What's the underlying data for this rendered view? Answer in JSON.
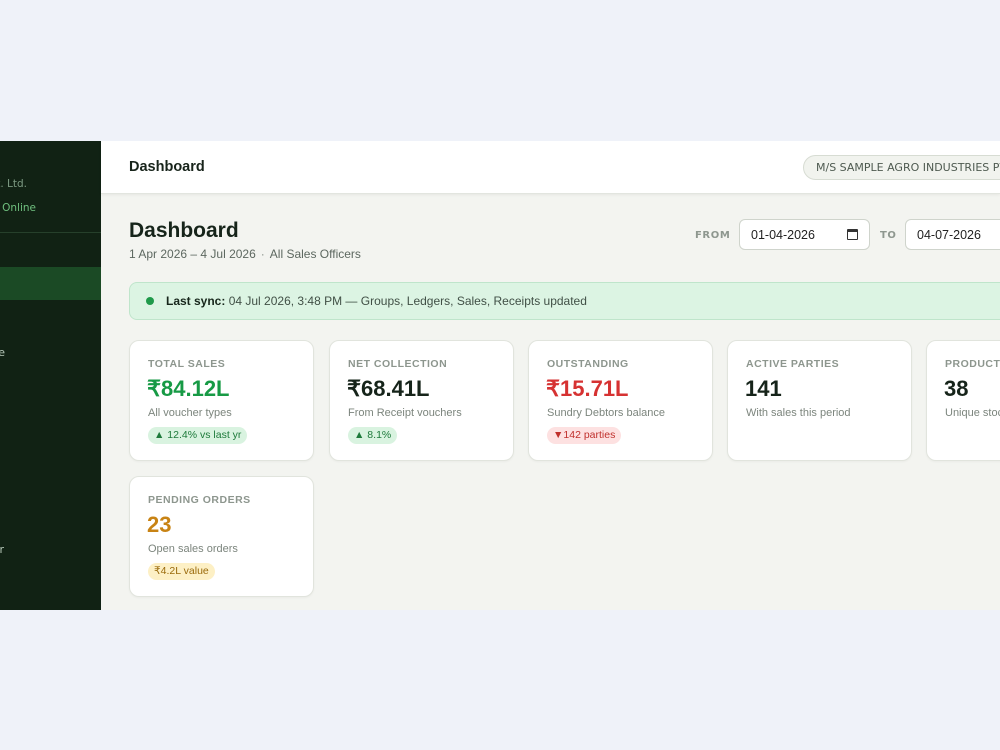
{
  "sidebar": {
    "company_suffix": "t. Ltd.",
    "status_text": "y Online",
    "items": [
      {
        "label": "e"
      },
      {
        "label": "r"
      }
    ]
  },
  "topbar": {
    "title": "Dashboard",
    "company_name": "M/S SAMPLE AGRO INDUSTRIES PV"
  },
  "page": {
    "title": "Dashboard",
    "date_range": "1 Apr 2026 – 4 Jul 2026",
    "officer_filter": "All Sales Officers",
    "separator": "·"
  },
  "filters": {
    "from_label": "FROM",
    "from_value": "01-04-2026",
    "to_label": "TO",
    "to_value": "04-07-2026"
  },
  "sync": {
    "label": "Last sync:",
    "text": " 04 Jul 2026, 3:48 PM — Groups, Ledgers, Sales, Receipts updated"
  },
  "cards": [
    {
      "label": "TOTAL SALES",
      "value": "₹84.12L",
      "desc": "All voucher types",
      "badge": "▲ 12.4% vs last yr"
    },
    {
      "label": "NET COLLECTION",
      "value": "₹68.41L",
      "desc": "From Receipt vouchers",
      "badge": "▲ 8.1%"
    },
    {
      "label": "OUTSTANDING",
      "value": "₹15.71L",
      "desc": "Sundry Debtors balance",
      "badge": "▼142 parties"
    },
    {
      "label": "ACTIVE PARTIES",
      "value": "141",
      "desc": "With sales this period"
    },
    {
      "label": "PRODUCT",
      "value": "38",
      "desc": "Unique stoc"
    },
    {
      "label": "PENDING ORDERS",
      "value": "23",
      "desc": "Open sales orders",
      "badge": "₹4.2L value"
    }
  ],
  "colors": {
    "sidebar_bg": "#112214",
    "positive": "#179a45",
    "negative": "#d63232",
    "warning": "#c88314",
    "sync_bg": "#dcf4e3"
  }
}
